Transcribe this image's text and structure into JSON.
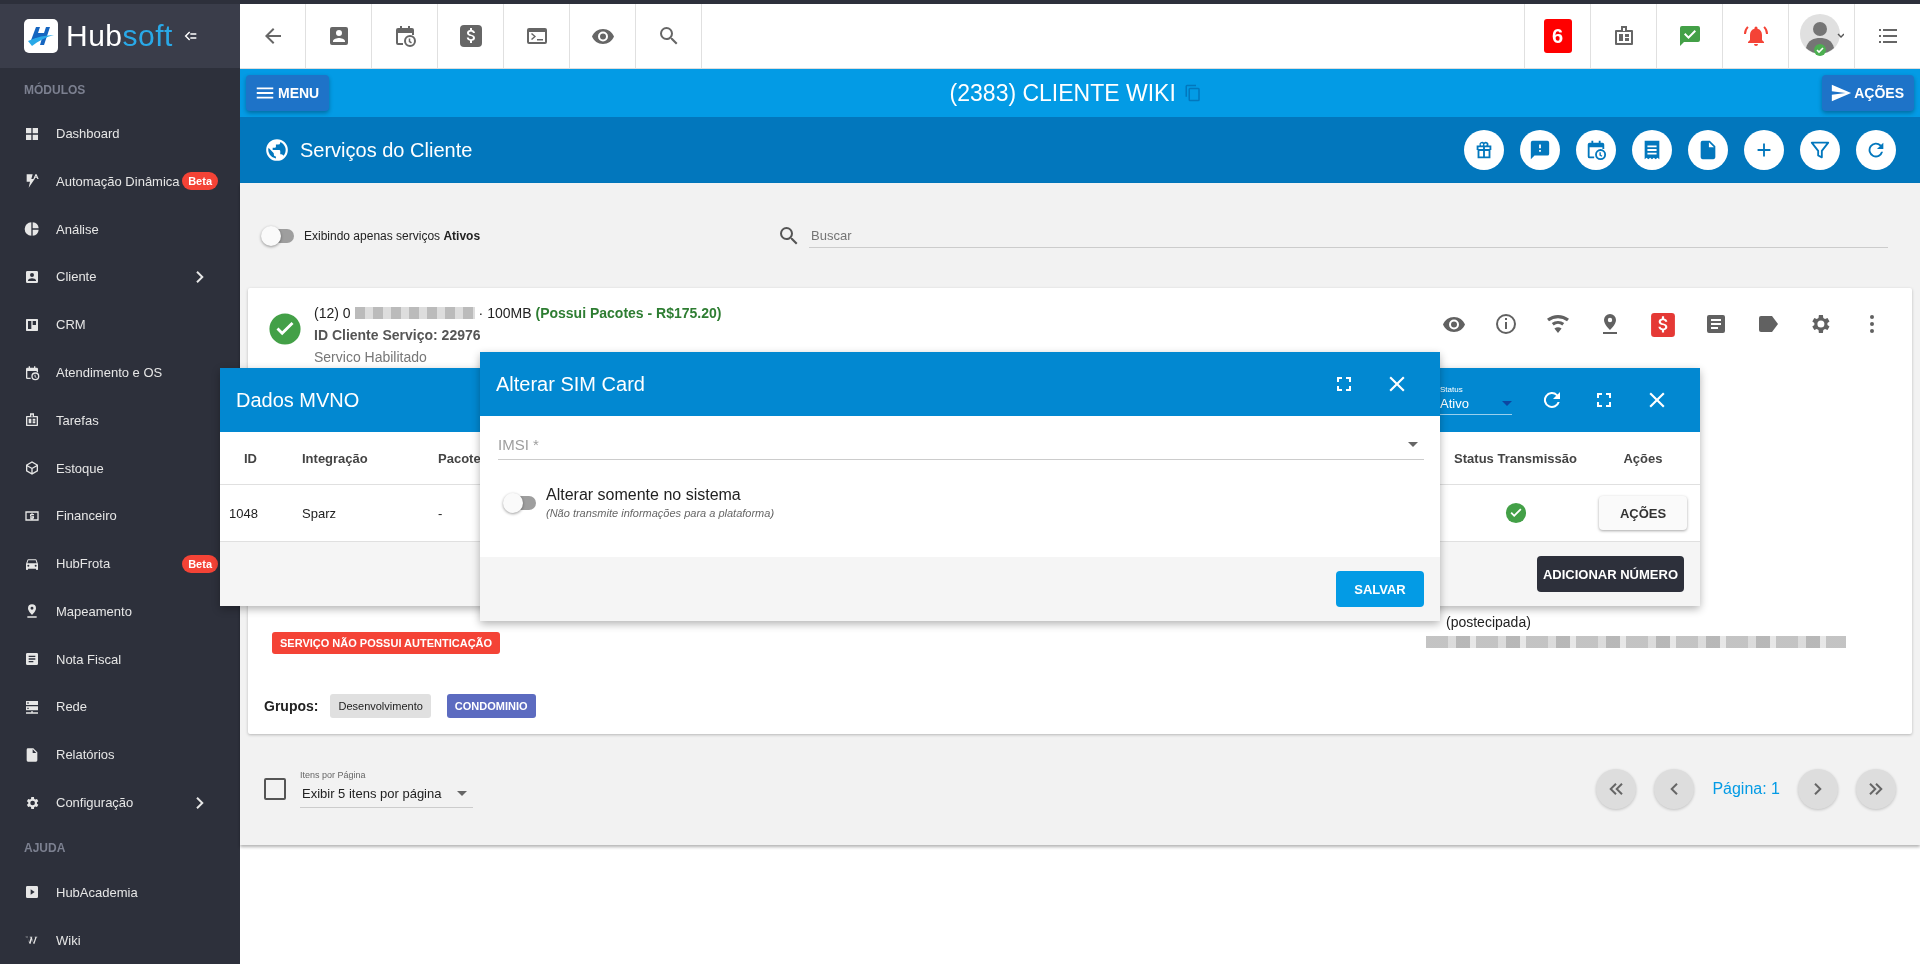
{
  "sidebar": {
    "logo": "Hubsoft",
    "sections": [
      {
        "title": "MÓDULOS",
        "items": [
          {
            "label": "Dashboard",
            "submenu": false
          },
          {
            "label": "Automação Dinâmica",
            "badge": "Beta",
            "submenu": false
          },
          {
            "label": "Análise",
            "submenu": false
          },
          {
            "label": "Cliente",
            "submenu": true
          },
          {
            "label": "CRM",
            "submenu": false
          },
          {
            "label": "Atendimento e OS",
            "submenu": false
          },
          {
            "label": "Tarefas",
            "submenu": false
          },
          {
            "label": "Estoque",
            "submenu": false
          },
          {
            "label": "Financeiro",
            "submenu": false
          },
          {
            "label": "HubFrota",
            "badge": "Beta",
            "submenu": false
          },
          {
            "label": "Mapeamento",
            "submenu": false
          },
          {
            "label": "Nota Fiscal",
            "submenu": false
          },
          {
            "label": "Rede",
            "submenu": false
          },
          {
            "label": "Relatórios",
            "submenu": false
          },
          {
            "label": "Configuração",
            "submenu": true
          }
        ]
      },
      {
        "title": "AJUDA",
        "items": [
          {
            "label": "HubAcademia",
            "submenu": false
          },
          {
            "label": "Wiki",
            "submenu": false
          }
        ]
      }
    ]
  },
  "topbar": {
    "notification_count": "6"
  },
  "header": {
    "menu_button": "MENU",
    "title": "(2383) CLIENTE WIKI",
    "actions_button": "AÇÕES"
  },
  "section": {
    "title": "Serviços do Cliente"
  },
  "filter": {
    "toggle_label": "Exibindo apenas serviços **Ativos**",
    "on": false,
    "search_placeholder": "Buscar"
  },
  "service": {
    "number_prefix": "(12) 0",
    "number_suffix": "· 100MB",
    "packages": "(Possui Pacotes - R$175.20)",
    "id_line": "ID Cliente Serviço: 22976",
    "status": "Servico Habilitado",
    "billing_note": "(postecipada)",
    "auth_badge": "SERVIÇO NÃO POSSUI AUTENTICAÇÃO",
    "groups_label": "Grupos:",
    "groups": [
      {
        "label": "Desenvolvimento",
        "color": "#e0e0e0"
      },
      {
        "label": "CONDOMINIO",
        "color": "#5c6bc0"
      }
    ]
  },
  "mvno_dialog": {
    "title": "Dados MVNO",
    "status_label": "Status",
    "status_value": "Ativo",
    "columns": [
      "ID",
      "Integração",
      "Pacote",
      "Status Transmissão",
      "Ações"
    ],
    "rows": [
      {
        "cells": [
          "1048",
          "Sparz",
          "-"
        ],
        "transmitted": true,
        "action": "AÇÕES"
      }
    ],
    "add_button": "ADICIONAR NÚMERO"
  },
  "simcard_dialog": {
    "title": "Alterar SIM Card",
    "imsi_placeholder": "IMSI *",
    "toggle_label": "Alterar somente no sistema",
    "toggle_hint": "(Não transmite informações para a plataforma)",
    "on": false,
    "save_button": "SALVAR"
  },
  "pagination": {
    "select_all_checked": false,
    "per_page_label": "Itens por Página",
    "per_page_value": "Exibir 5 itens por página",
    "page_label": "Página: 1"
  }
}
